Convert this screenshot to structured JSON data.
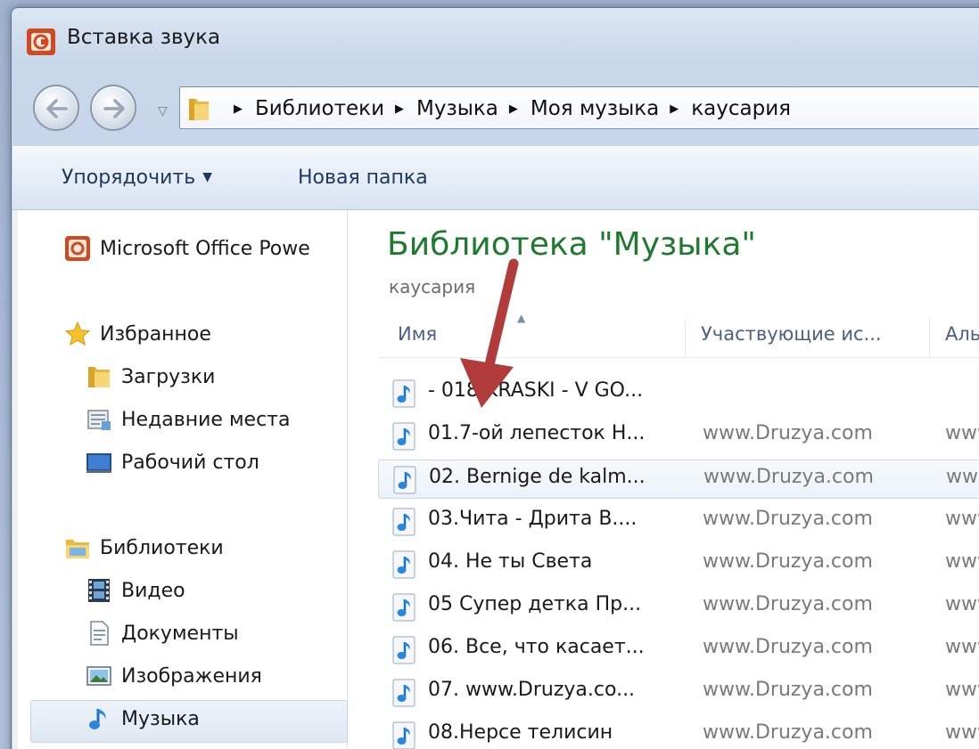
{
  "window": {
    "title": "Вставка звука"
  },
  "address": {
    "crumbs": [
      "Библиотеки",
      "Музыка",
      "Моя музыка",
      "каусария"
    ]
  },
  "toolbar": {
    "organize_label": "Упорядочить",
    "new_folder_label": "Новая папка"
  },
  "nav": {
    "app_item": "Microsoft Office Powe",
    "favorites": {
      "label": "Избранное",
      "items": [
        "Загрузки",
        "Недавние места",
        "Рабочий стол"
      ]
    },
    "libraries": {
      "label": "Библиотеки",
      "items": [
        "Видео",
        "Документы",
        "Изображения",
        "Музыка"
      ]
    }
  },
  "main": {
    "library_title": "Библиотека \"Музыка\"",
    "library_subtitle": "каусария",
    "columns": [
      "Имя",
      "Участвующие ис...",
      "Аль"
    ],
    "files": [
      {
        "name": "- 018 KRASKI - V GO...",
        "artist": "",
        "album": ""
      },
      {
        "name": "01.7-ой лепесток Н...",
        "artist": "www.Druzya.com",
        "album": "www"
      },
      {
        "name": "02. Bernige de kalm...",
        "artist": "www.Druzya.com",
        "album": "www"
      },
      {
        "name": "03.Чита - Дрита В....",
        "artist": "www.Druzya.com",
        "album": "www"
      },
      {
        "name": "04. Не ты Света",
        "artist": "www.Druzya.com",
        "album": "www"
      },
      {
        "name": "05 Супер детка Пр...",
        "artist": "www.Druzya.com",
        "album": "www"
      },
      {
        "name": "06. Все, что касает...",
        "artist": "www.Druzya.com",
        "album": "www"
      },
      {
        "name": "07. www.Druzya.co...",
        "artist": "www.Druzya.com",
        "album": "www"
      },
      {
        "name": "08.Нерсе телисин",
        "artist": "www.Druzya.com",
        "album": "www"
      }
    ]
  },
  "colors": {
    "title_green": "#1e7a2e",
    "annotation_arrow": "#b23b3b",
    "toolbar_text": "#1e395b"
  }
}
